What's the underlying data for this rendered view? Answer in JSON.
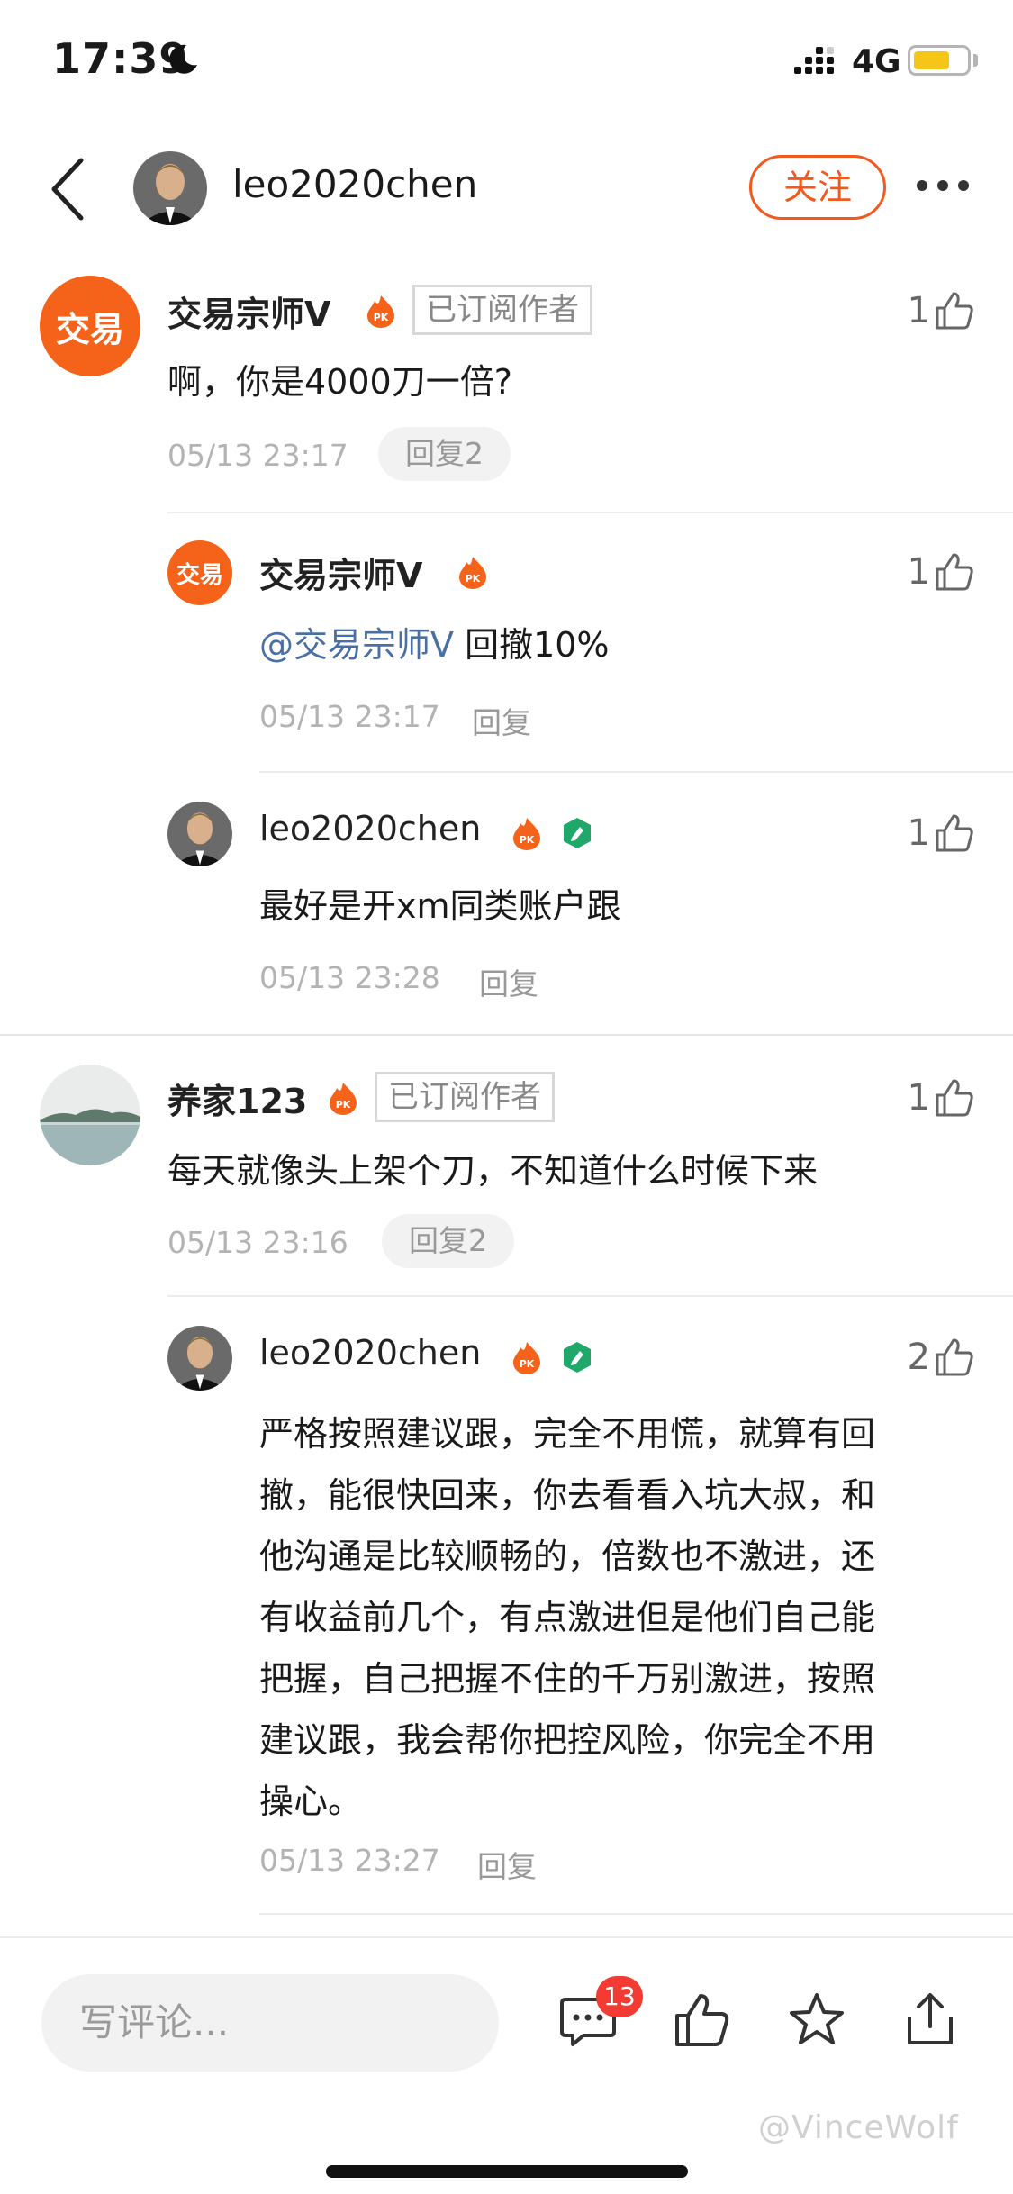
{
  "status_bar": {
    "time": "17:39",
    "network": "4G",
    "battery_color": "#f5c518"
  },
  "header": {
    "username": "leo2020chen",
    "follow_label": "关注"
  },
  "colors": {
    "accent": "#f2591f",
    "mention": "#4a6fa5",
    "badge_red": "#f33b34"
  },
  "comments": [
    {
      "author": "交易宗师V",
      "avatar_text": "交易",
      "subscribed_label": "已订阅作者",
      "likes": "1",
      "text": "啊，你是4000刀一倍?",
      "time": "05/13 23:17",
      "reply_label": "回复2",
      "replies": [
        {
          "author": "交易宗师V",
          "avatar_text": "交易",
          "likes": "1",
          "mention": "@交易宗师V",
          "text": " 回撤10%",
          "time": "05/13 23:17",
          "reply_label": "回复"
        },
        {
          "author": "leo2020chen",
          "likes": "1",
          "text": "最好是开xm同类账户跟",
          "time": "05/13 23:28",
          "reply_label": "回复"
        }
      ]
    },
    {
      "author": "养家123",
      "subscribed_label": "已订阅作者",
      "likes": "1",
      "text": "每天就像头上架个刀，不知道什么时候下来",
      "time": "05/13 23:16",
      "reply_label": "回复2",
      "replies": [
        {
          "author": "leo2020chen",
          "likes": "2",
          "lines": [
            "严格按照建议跟，完全不用慌，就算有回",
            "撤，能很快回来，你去看看入坑大叔，和",
            "他沟通是比较顺畅的，倍数也不激进，还",
            "有收益前几个，有点激进但是他们自己能",
            "把握，自己把握不住的千万别激进，按照",
            "建议跟，我会帮你把控风险，你完全不用",
            "操心。"
          ],
          "time": "05/13 23:27",
          "reply_label": "回复"
        }
      ]
    }
  ],
  "bottom_bar": {
    "input_placeholder": "写评论...",
    "comment_count": "13",
    "watermark": "@VinceWolf"
  }
}
